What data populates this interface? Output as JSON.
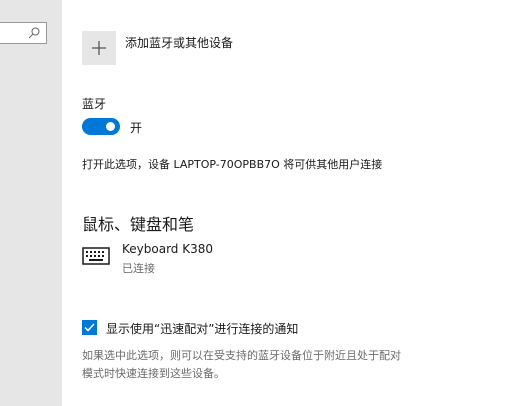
{
  "colors": {
    "accent": "#0078d7",
    "nav_background": "#e6e6e6",
    "secondary_text": "#6b6b6b"
  },
  "icons": {
    "search": "search-icon",
    "add": "plus-icon",
    "device": "keyboard-icon",
    "checkbox": "check-icon"
  },
  "add_device": {
    "label": "添加蓝牙或其他设备"
  },
  "bluetooth": {
    "heading": "蓝牙",
    "toggle_state": "开",
    "toggle_on": true,
    "discoverable_text": "打开此选项，设备 LAPTOP-70OPBB7O 将可供其他用户连接"
  },
  "devices_section": {
    "heading": "鼠标、键盘和笔",
    "devices": [
      {
        "name": "Keyboard K380",
        "status": "已连接"
      }
    ]
  },
  "swift_pair": {
    "checked": true,
    "label": "显示使用“迅速配对”进行连接的通知",
    "description_line1": "如果选中此选项，则可以在受支持的蓝牙设备位于附近且处于配对",
    "description_line2": "模式时快速连接到这些设备。"
  }
}
